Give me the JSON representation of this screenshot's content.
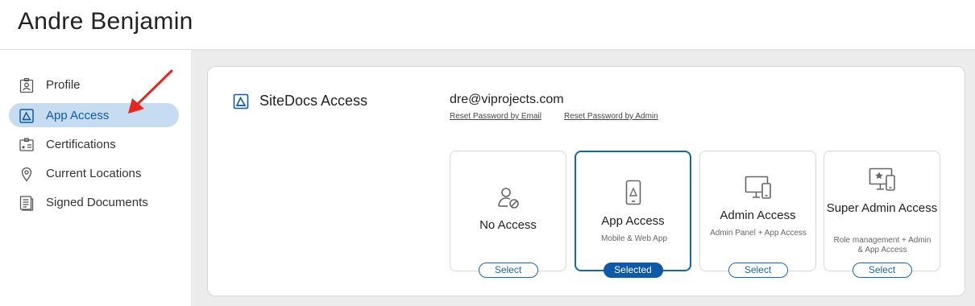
{
  "header": {
    "title": "Andre Benjamin"
  },
  "sidebar": {
    "items": [
      {
        "label": "Profile",
        "icon": "id-badge-icon",
        "active": false
      },
      {
        "label": "App Access",
        "icon": "app-access-icon",
        "active": true
      },
      {
        "label": "Certifications",
        "icon": "certificate-icon",
        "active": false
      },
      {
        "label": "Current Locations",
        "icon": "location-pin-icon",
        "active": false
      },
      {
        "label": "Signed Documents",
        "icon": "document-icon",
        "active": false
      }
    ]
  },
  "access": {
    "section_title": "SiteDocs Access",
    "email": "dre@viprojects.com",
    "reset_email_label": "Reset Password by Email",
    "reset_admin_label": "Reset Password by Admin",
    "options": [
      {
        "title": "No Access",
        "subtitle": "",
        "button": "Select",
        "selected": false,
        "icon": "no-access-user-icon"
      },
      {
        "title": "App Access",
        "subtitle": "Mobile & Web App",
        "button": "Selected",
        "selected": true,
        "icon": "mobile-phone-icon"
      },
      {
        "title": "Admin Access",
        "subtitle": "Admin Panel + App Access",
        "button": "Select",
        "selected": false,
        "icon": "desktop-mobile-icon"
      },
      {
        "title": "Super Admin Access",
        "subtitle": "Role management + Admin & App Access",
        "button": "Select",
        "selected": false,
        "icon": "desktop-star-icon"
      }
    ]
  },
  "colors": {
    "accent": "#0f5aa8",
    "active_bg": "#c5dcf1",
    "arrow": "#e8251f",
    "main_bg": "#ececec"
  }
}
